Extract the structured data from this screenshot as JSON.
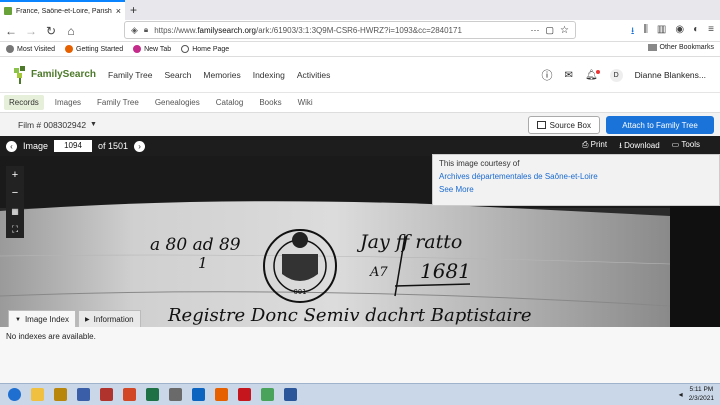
{
  "browser": {
    "tab_title": "France, Saône-et-Loire, Parish ...",
    "url_prefix": "https://www.",
    "url_domain": "familysearch.org",
    "url_path": "/ark:/61903/3:1:3Q9M-CSR6-HWRZ?i=1093&cc=2840171",
    "bookmarks": [
      "Most Visited",
      "Getting Started",
      "New Tab",
      "Home Page"
    ],
    "other_bookmarks": "Other Bookmarks"
  },
  "fs": {
    "logo": "FamilySearch",
    "menu": [
      "Family Tree",
      "Search",
      "Memories",
      "Indexing",
      "Activities"
    ],
    "avatar_initial": "D",
    "user": "Dianne Blankens...",
    "subnav": [
      "Records",
      "Images",
      "Family Tree",
      "Genealogies",
      "Catalog",
      "Books",
      "Wiki"
    ]
  },
  "film": {
    "label": "Film # 008302942",
    "source_box": "Source Box",
    "attach": "Attach to Family Tree"
  },
  "viewer": {
    "image_label": "Image",
    "image_number": "1094",
    "of_label": "of 1501",
    "print": "Print",
    "download": "Download",
    "tools": "Tools",
    "courtesy_text": "This image courtesy of",
    "courtesy_link": "Archives départementales de Saône-et-Loire",
    "see_more": "See More",
    "manuscript": {
      "line1": "a 80 ad 89",
      "line2": "1",
      "right": "Jay ff ratto",
      "year": "1681",
      "a7": "A7",
      "bottom": "Registre Donc Semiv dachrt Baptistaire",
      "seal_number": "001"
    }
  },
  "index": {
    "tab_index": "Image Index",
    "tab_info": "Information",
    "empty": "No indexes are available."
  },
  "taskbar": {
    "time": "5:11 PM",
    "date": "2/3/2021",
    "icons": [
      "start-button",
      "explorer-icon",
      "media-icon",
      "network-icon",
      "app-icon",
      "powerpoint-icon",
      "excel-icon",
      "photos-icon",
      "outlook-icon",
      "firefox-icon",
      "acrobat-icon",
      "paint-icon",
      "word-icon"
    ],
    "colors": [
      "#1f6fd0",
      "#f0c040",
      "#b8860b",
      "#3a5fa8",
      "#b0332e",
      "#d24726",
      "#1e7145",
      "#6a6a6a",
      "#0b64c0",
      "#e66000",
      "#c4161c",
      "#4aa35a",
      "#2b579a"
    ]
  }
}
